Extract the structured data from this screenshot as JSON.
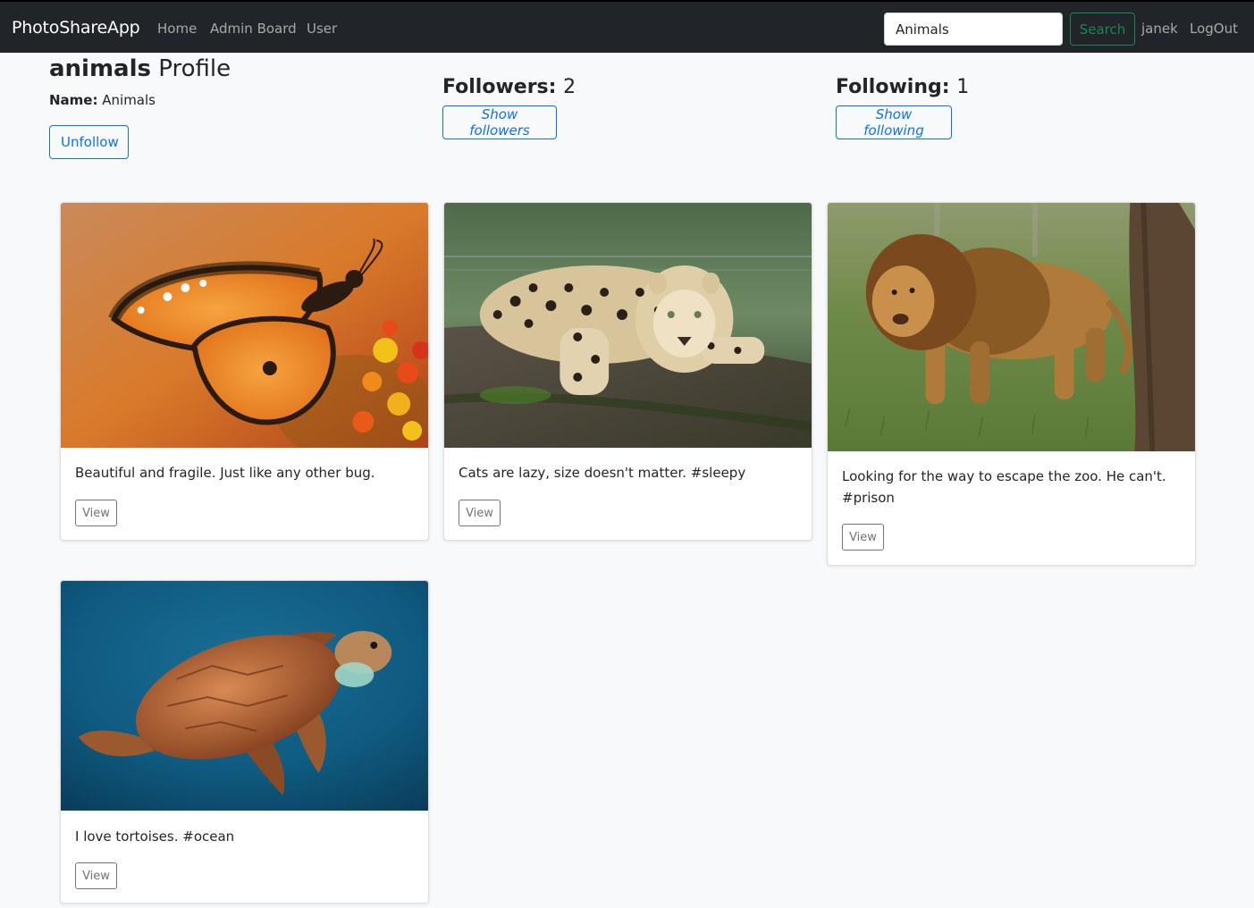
{
  "navbar": {
    "brand": "PhotoShareApp",
    "links": {
      "home": "Home",
      "admin_board": "Admin Board",
      "user": "User"
    },
    "search": {
      "value": "Animals",
      "button_label": "Search"
    },
    "username": "janek",
    "logout_label": "LogOut",
    "colors": {
      "background": "#212529",
      "search_button": "#198754"
    }
  },
  "profile": {
    "username": "animals",
    "title_suffix": " Profile",
    "name_label": "Name:",
    "name_value": " Animals",
    "unfollow_label": "Unfollow",
    "followers": {
      "label": "Followers: ",
      "count": "2",
      "button_label": "Show followers"
    },
    "following": {
      "label": "Following: ",
      "count": "1",
      "button_label": "Show following"
    },
    "accent_color": "#0d6efd"
  },
  "photos": [
    {
      "subject": "butterfly",
      "description": "Beautiful and fragile. Just like any other bug.",
      "view_label": "View"
    },
    {
      "subject": "leopard",
      "description": "Cats are lazy, size doesn't matter. #sleepy",
      "view_label": "View"
    },
    {
      "subject": "lion",
      "description": "Looking for the way to escape the zoo. He can't. #prison",
      "view_label": "View"
    },
    {
      "subject": "sea-turtle",
      "description": "I love tortoises. #ocean",
      "view_label": "View"
    }
  ]
}
